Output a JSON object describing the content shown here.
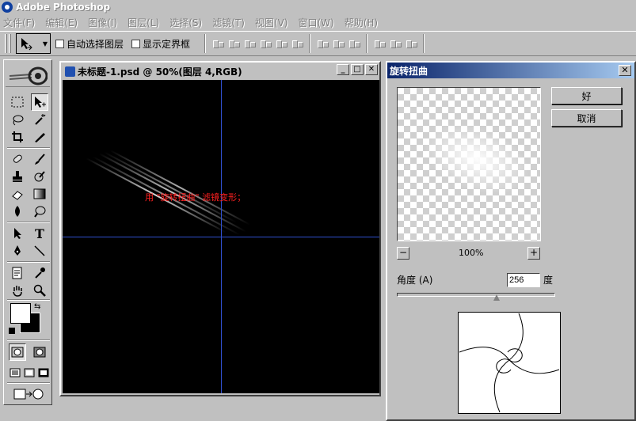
{
  "app": {
    "title": "Adobe Photoshop"
  },
  "menu": [
    "文件(F)",
    "编辑(E)",
    "图像(I)",
    "图层(L)",
    "选择(S)",
    "滤镜(T)",
    "视图(V)",
    "窗口(W)",
    "帮助(H)"
  ],
  "options": {
    "auto_select_label": "自动选择图层",
    "show_bounds_label": "显示定界框"
  },
  "document": {
    "title": "未标题-1.psd @ 50%(图层 4,RGB)",
    "canvas_note": "用 \"旋转扭曲\" 滤镜变形；"
  },
  "dialog": {
    "title": "旋转扭曲",
    "ok_label": "好",
    "cancel_label": "取消",
    "zoom_minus": "−",
    "zoom_value": "100%",
    "zoom_plus": "+",
    "angle_label": "角度 (A)",
    "angle_value": "256",
    "angle_unit": "度",
    "angle_slider_fraction": 0.63
  },
  "toolbox": {
    "tools": [
      "marquee-icon",
      "move-icon",
      "lasso-icon",
      "magic-wand-icon",
      "crop-icon",
      "slice-icon",
      "healing-brush-icon",
      "brush-icon",
      "clone-stamp-icon",
      "history-brush-icon",
      "eraser-icon",
      "gradient-icon",
      "blur-icon",
      "dodge-icon",
      "path-select-icon",
      "type-icon",
      "pen-icon",
      "line-icon",
      "notes-icon",
      "eyedropper-icon",
      "hand-icon",
      "zoom-icon"
    ]
  },
  "colors": {
    "accent": "#0a246a",
    "guide": "#3050d0",
    "annotation": "#ff2020"
  }
}
